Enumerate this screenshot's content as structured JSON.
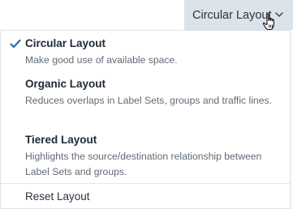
{
  "trigger": {
    "label": "Circular Layout"
  },
  "menu": {
    "items": [
      {
        "title": "Circular Layout",
        "description": "Make good use of available space.",
        "selected": true
      },
      {
        "title": "Organic Layout",
        "description": "Reduces overlaps in Label Sets, groups and traffic lines.",
        "selected": false
      },
      {
        "title": "Tiered Layout",
        "description": "Highlights the source/destination relationship between Label Sets and groups.",
        "selected": false
      }
    ],
    "reset_label": "Reset Layout"
  },
  "icons": {
    "selected": "checkmark-icon",
    "dropdown": "chevron-down-icon",
    "pointer": "hand-pointer-cursor-icon"
  },
  "colors": {
    "accent": "#2a6db5",
    "trigger_background": "#dde3ea",
    "title_text": "#202a35",
    "description_text": "#616b76"
  }
}
